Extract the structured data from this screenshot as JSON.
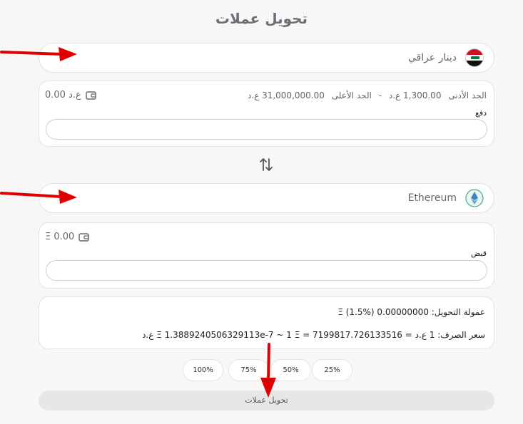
{
  "page": {
    "title": "تحويل عملات"
  },
  "from": {
    "currency_name": "دينار عراقي",
    "icon": "iraq-flag-icon",
    "balance": "0.00 ع.د",
    "limits": {
      "min_label": "الحد الأدنى",
      "min_value": "1,300.00 ع.د",
      "separator": "-",
      "max_label": "الحد الأعلى",
      "max_value": "31,000,000.00 ع.د"
    },
    "field_label": "دفع",
    "value": ""
  },
  "to": {
    "currency_name": "Ethereum",
    "icon": "ethereum-icon",
    "balance": "Ξ 0.00",
    "field_label": "قبض",
    "value": ""
  },
  "info": {
    "fee": "عمولة التحويل: 0.00000000 Ξ (1.5%)",
    "rate": "سعر الصرف: 1 ع.د = Ξ 1.3889240506329113e-7 ~ 1 Ξ = 7199817.726133516 ع.د"
  },
  "percent_buttons": [
    "100%",
    "75%",
    "50%",
    "25%"
  ],
  "convert_button": "تحويل عملات",
  "colors": {
    "annotation_arrow": "#e00000",
    "page_background": "#f7f7f8"
  }
}
